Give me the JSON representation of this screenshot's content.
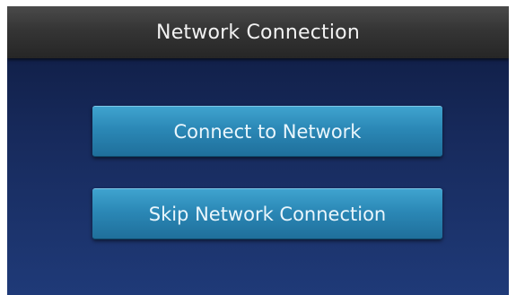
{
  "header": {
    "title": "Network Connection"
  },
  "actions": {
    "connect_label": "Connect to Network",
    "skip_label": "Skip Network Connection"
  },
  "colors": {
    "title_bar": "#353535",
    "background_top": "#0e1a3e",
    "background_bottom": "#1f3a78",
    "button_accent": "#2b88b6",
    "text": "#f2f2f2"
  }
}
